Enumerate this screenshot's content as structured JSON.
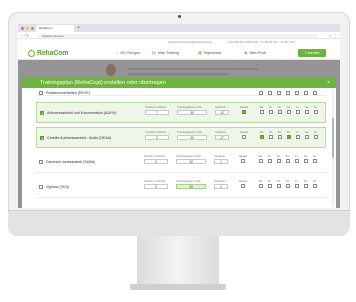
{
  "browser": {
    "tab_title": "RehaCom",
    "tab_add": "+",
    "url": "rehacom.de/neu",
    "nav": "‹ › ↻",
    "menu": "☆ ⋮",
    "dot_colors": [
      "#ee6a5f",
      "#f5be4f",
      "#62c554"
    ]
  },
  "topinfo": {
    "email": "hasomedrehacom@hasomed.de",
    "phone": "+49 391 610 7650 (Mo - Fr 08:00 Uhr - 16:30 Uhr)"
  },
  "app": {
    "logo": "RehaCom",
    "nav": [
      {
        "icon": "⌂",
        "label": "Mit Übungen",
        "active": true
      },
      {
        "icon": "▤",
        "label": "Mein Training",
        "active": false
      },
      {
        "icon": "▦",
        "label": "Ergebnisse",
        "active": false
      },
      {
        "icon": "◉",
        "label": "Mein Profil",
        "active": false
      }
    ],
    "help_button": "+ Anrufen",
    "accent": "#6cb33f"
  },
  "modal": {
    "title": "Trainingsplan (RehaCept) erstellen oder übertragen",
    "close": "×",
    "captions": {
      "per_week": "Anzahl pro Woche",
      "duration": "Trainingsdauer in Min.",
      "start_level": "Startlevel",
      "no_date": "Nodate"
    },
    "day_labels": [
      "Mo",
      "Di",
      "Mi",
      "Do",
      "Fr",
      "Sa",
      "So"
    ],
    "rows": [
      {
        "label": "Reaktionsverhalten (REVE)",
        "selected": false,
        "partial": true,
        "per_week": "",
        "duration": "",
        "start_level": "",
        "nodate": false,
        "days": [
          false,
          false,
          false,
          false,
          false,
          false,
          false
        ]
      },
      {
        "label": "Aufmerksamkeit und Konzentration (AUFM)",
        "selected": true,
        "per_week": "7",
        "duration": "30",
        "start_level": "12",
        "nodate": true,
        "days": [
          false,
          false,
          false,
          false,
          false,
          false,
          false
        ]
      },
      {
        "label": "Geteilte Aufmerksamkeit - Audio (DEAA)",
        "selected": true,
        "per_week": "2",
        "duration": "30",
        "start_level": "17",
        "nodate": false,
        "days": [
          true,
          false,
          false,
          true,
          false,
          false,
          false
        ]
      },
      {
        "label": "Dauerauf merksamkeit (SUBA)",
        "selected": false,
        "per_week": "0",
        "duration": "30",
        "start_level": "1",
        "nodate": false,
        "days": [
          false,
          false,
          false,
          false,
          false,
          false,
          false
        ]
      },
      {
        "label": "Vigilanz (VIGI)",
        "selected": false,
        "per_week": "0",
        "duration": "20",
        "start_level": "1",
        "nodate": false,
        "days": [
          false,
          false,
          false,
          false,
          false,
          false,
          false
        ]
      }
    ]
  }
}
